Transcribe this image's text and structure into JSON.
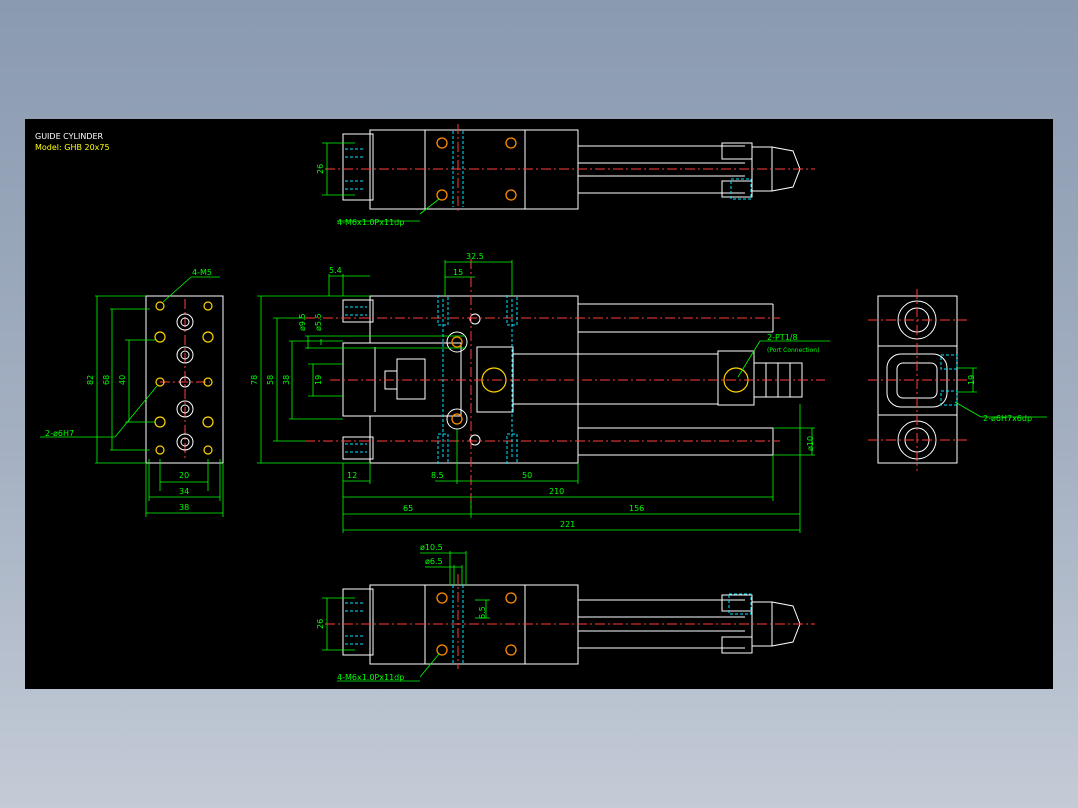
{
  "title": {
    "name": "GUIDE CYLINDER",
    "model": "Model: GHB 20x75"
  },
  "colors": {
    "background": "#000000",
    "outline": "#ffffff",
    "centerline": "#ff3b3b",
    "hidden": "#00e5ff",
    "dimension": "#00ff00",
    "hole": "#ffd400"
  },
  "top_view": {
    "dim_height": "26",
    "callout": "4-M6x1.0Px11dp"
  },
  "end_view": {
    "callout_top": "4-M5",
    "callout_bottom": "2-ø6H7",
    "dim_82": "82",
    "dim_68": "68",
    "dim_40": "40",
    "dim_20": "20",
    "dim_34": "34",
    "dim_38": "38"
  },
  "front_view": {
    "dim_78": "78",
    "dim_58": "58",
    "dim_38": "38",
    "dim_19": "19",
    "dim_5_4": "5.4",
    "dim_d9_5": "ø9.5",
    "dim_d5_5": "ø5.5",
    "dim_32_5": "32.5",
    "dim_15": "15",
    "dim_12": "12",
    "dim_8_5": "8.5",
    "dim_50": "50",
    "dim_210": "210",
    "dim_65": "65",
    "dim_156": "156",
    "dim_221": "221",
    "dim_d10": "ø10",
    "port_callout": "2-PT1/8",
    "port_note": "(Port Connection)"
  },
  "right_view": {
    "dim_19": "19",
    "callout": "2-ø6H7x6dp"
  },
  "bottom_view": {
    "dim_d10_5": "ø10.5",
    "dim_d6_5": "ø6.5",
    "dim_6_5": "6.5",
    "dim_height": "26",
    "callout": "4-M6x1.0Px11dp"
  }
}
